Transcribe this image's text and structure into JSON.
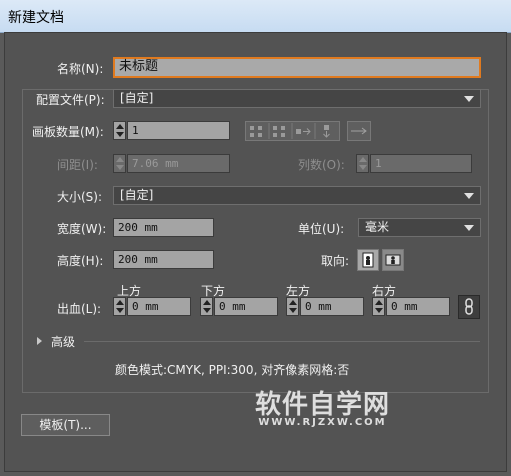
{
  "window": {
    "title": "新建文档"
  },
  "name": {
    "label": "名称(N):",
    "value": "未标题"
  },
  "profile": {
    "label": "配置文件(P):",
    "value": "[自定]"
  },
  "artboards": {
    "label": "画板数量(M):",
    "value": "1"
  },
  "spacing": {
    "label": "间距(I):",
    "value": "7.06 mm"
  },
  "columns": {
    "label": "列数(O):",
    "value": "1"
  },
  "size": {
    "label": "大小(S):",
    "value": "[自定]"
  },
  "width": {
    "label": "宽度(W):",
    "value": "200 mm"
  },
  "units": {
    "label": "单位(U):",
    "value": "毫米"
  },
  "height": {
    "label": "高度(H):",
    "value": "200 mm"
  },
  "orientation": {
    "label": "取向:"
  },
  "bleed": {
    "label": "出血(L):",
    "top": {
      "label": "上方",
      "value": "0 mm"
    },
    "bottom": {
      "label": "下方",
      "value": "0 mm"
    },
    "left": {
      "label": "左方",
      "value": "0 mm"
    },
    "right": {
      "label": "右方",
      "value": "0 mm"
    }
  },
  "advanced": {
    "label": "高级"
  },
  "info": {
    "text": "颜色模式:CMYK, PPI:300, 对齐像素网格:否"
  },
  "template_button": {
    "label": "模板(T)..."
  },
  "watermark": {
    "big": "软件自学网",
    "small": "WWW.RJZXW.COM"
  }
}
